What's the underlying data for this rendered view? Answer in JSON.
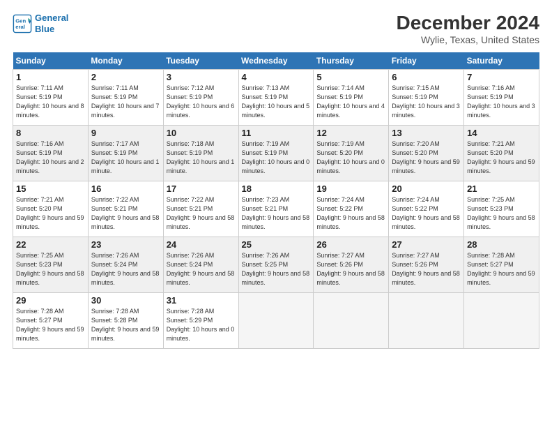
{
  "logo": {
    "line1": "General",
    "line2": "Blue"
  },
  "title": "December 2024",
  "subtitle": "Wylie, Texas, United States",
  "days_header": [
    "Sunday",
    "Monday",
    "Tuesday",
    "Wednesday",
    "Thursday",
    "Friday",
    "Saturday"
  ],
  "weeks": [
    [
      {
        "num": "1",
        "sunrise": "Sunrise: 7:11 AM",
        "sunset": "Sunset: 5:19 PM",
        "daylight": "Daylight: 10 hours and 8 minutes."
      },
      {
        "num": "2",
        "sunrise": "Sunrise: 7:11 AM",
        "sunset": "Sunset: 5:19 PM",
        "daylight": "Daylight: 10 hours and 7 minutes."
      },
      {
        "num": "3",
        "sunrise": "Sunrise: 7:12 AM",
        "sunset": "Sunset: 5:19 PM",
        "daylight": "Daylight: 10 hours and 6 minutes."
      },
      {
        "num": "4",
        "sunrise": "Sunrise: 7:13 AM",
        "sunset": "Sunset: 5:19 PM",
        "daylight": "Daylight: 10 hours and 5 minutes."
      },
      {
        "num": "5",
        "sunrise": "Sunrise: 7:14 AM",
        "sunset": "Sunset: 5:19 PM",
        "daylight": "Daylight: 10 hours and 4 minutes."
      },
      {
        "num": "6",
        "sunrise": "Sunrise: 7:15 AM",
        "sunset": "Sunset: 5:19 PM",
        "daylight": "Daylight: 10 hours and 3 minutes."
      },
      {
        "num": "7",
        "sunrise": "Sunrise: 7:16 AM",
        "sunset": "Sunset: 5:19 PM",
        "daylight": "Daylight: 10 hours and 3 minutes."
      }
    ],
    [
      {
        "num": "8",
        "sunrise": "Sunrise: 7:16 AM",
        "sunset": "Sunset: 5:19 PM",
        "daylight": "Daylight: 10 hours and 2 minutes."
      },
      {
        "num": "9",
        "sunrise": "Sunrise: 7:17 AM",
        "sunset": "Sunset: 5:19 PM",
        "daylight": "Daylight: 10 hours and 1 minute."
      },
      {
        "num": "10",
        "sunrise": "Sunrise: 7:18 AM",
        "sunset": "Sunset: 5:19 PM",
        "daylight": "Daylight: 10 hours and 1 minute."
      },
      {
        "num": "11",
        "sunrise": "Sunrise: 7:19 AM",
        "sunset": "Sunset: 5:19 PM",
        "daylight": "Daylight: 10 hours and 0 minutes."
      },
      {
        "num": "12",
        "sunrise": "Sunrise: 7:19 AM",
        "sunset": "Sunset: 5:20 PM",
        "daylight": "Daylight: 10 hours and 0 minutes."
      },
      {
        "num": "13",
        "sunrise": "Sunrise: 7:20 AM",
        "sunset": "Sunset: 5:20 PM",
        "daylight": "Daylight: 9 hours and 59 minutes."
      },
      {
        "num": "14",
        "sunrise": "Sunrise: 7:21 AM",
        "sunset": "Sunset: 5:20 PM",
        "daylight": "Daylight: 9 hours and 59 minutes."
      }
    ],
    [
      {
        "num": "15",
        "sunrise": "Sunrise: 7:21 AM",
        "sunset": "Sunset: 5:20 PM",
        "daylight": "Daylight: 9 hours and 59 minutes."
      },
      {
        "num": "16",
        "sunrise": "Sunrise: 7:22 AM",
        "sunset": "Sunset: 5:21 PM",
        "daylight": "Daylight: 9 hours and 58 minutes."
      },
      {
        "num": "17",
        "sunrise": "Sunrise: 7:22 AM",
        "sunset": "Sunset: 5:21 PM",
        "daylight": "Daylight: 9 hours and 58 minutes."
      },
      {
        "num": "18",
        "sunrise": "Sunrise: 7:23 AM",
        "sunset": "Sunset: 5:21 PM",
        "daylight": "Daylight: 9 hours and 58 minutes."
      },
      {
        "num": "19",
        "sunrise": "Sunrise: 7:24 AM",
        "sunset": "Sunset: 5:22 PM",
        "daylight": "Daylight: 9 hours and 58 minutes."
      },
      {
        "num": "20",
        "sunrise": "Sunrise: 7:24 AM",
        "sunset": "Sunset: 5:22 PM",
        "daylight": "Daylight: 9 hours and 58 minutes."
      },
      {
        "num": "21",
        "sunrise": "Sunrise: 7:25 AM",
        "sunset": "Sunset: 5:23 PM",
        "daylight": "Daylight: 9 hours and 58 minutes."
      }
    ],
    [
      {
        "num": "22",
        "sunrise": "Sunrise: 7:25 AM",
        "sunset": "Sunset: 5:23 PM",
        "daylight": "Daylight: 9 hours and 58 minutes."
      },
      {
        "num": "23",
        "sunrise": "Sunrise: 7:26 AM",
        "sunset": "Sunset: 5:24 PM",
        "daylight": "Daylight: 9 hours and 58 minutes."
      },
      {
        "num": "24",
        "sunrise": "Sunrise: 7:26 AM",
        "sunset": "Sunset: 5:24 PM",
        "daylight": "Daylight: 9 hours and 58 minutes."
      },
      {
        "num": "25",
        "sunrise": "Sunrise: 7:26 AM",
        "sunset": "Sunset: 5:25 PM",
        "daylight": "Daylight: 9 hours and 58 minutes."
      },
      {
        "num": "26",
        "sunrise": "Sunrise: 7:27 AM",
        "sunset": "Sunset: 5:26 PM",
        "daylight": "Daylight: 9 hours and 58 minutes."
      },
      {
        "num": "27",
        "sunrise": "Sunrise: 7:27 AM",
        "sunset": "Sunset: 5:26 PM",
        "daylight": "Daylight: 9 hours and 58 minutes."
      },
      {
        "num": "28",
        "sunrise": "Sunrise: 7:28 AM",
        "sunset": "Sunset: 5:27 PM",
        "daylight": "Daylight: 9 hours and 59 minutes."
      }
    ],
    [
      {
        "num": "29",
        "sunrise": "Sunrise: 7:28 AM",
        "sunset": "Sunset: 5:27 PM",
        "daylight": "Daylight: 9 hours and 59 minutes."
      },
      {
        "num": "30",
        "sunrise": "Sunrise: 7:28 AM",
        "sunset": "Sunset: 5:28 PM",
        "daylight": "Daylight: 9 hours and 59 minutes."
      },
      {
        "num": "31",
        "sunrise": "Sunrise: 7:28 AM",
        "sunset": "Sunset: 5:29 PM",
        "daylight": "Daylight: 10 hours and 0 minutes."
      },
      null,
      null,
      null,
      null
    ]
  ]
}
